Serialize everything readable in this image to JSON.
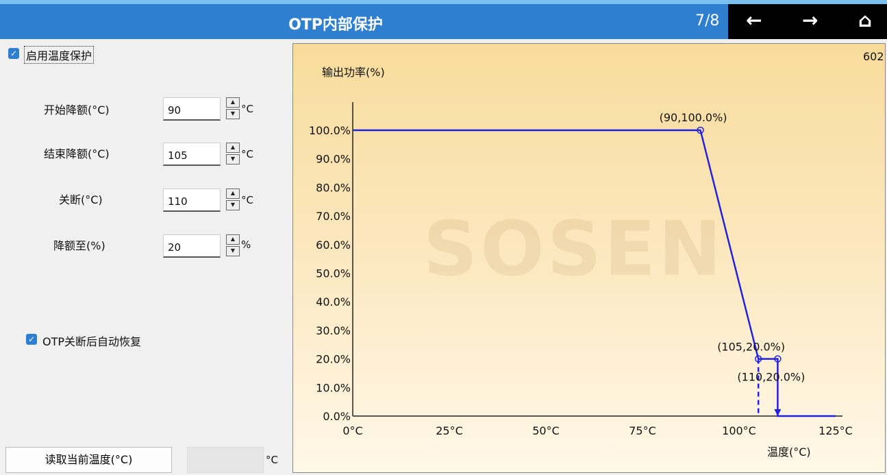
{
  "header": {
    "title": "OTP内部保护",
    "page_indicator": "7/8",
    "back_icon": "←",
    "forward_icon": "→",
    "home_icon": "⌂"
  },
  "settings": {
    "enable_label": "启用温度保护",
    "enable_checked": true,
    "start_derating": {
      "label": "开始降额(°C)",
      "value": "90",
      "unit": "°C"
    },
    "end_derating": {
      "label": "结束降额(°C)",
      "value": "105",
      "unit": "°C"
    },
    "shutdown": {
      "label": "关断(°C)",
      "value": "110",
      "unit": "°C"
    },
    "derate_to": {
      "label": "降额至(%)",
      "value": "20",
      "unit": "%"
    },
    "auto_recover_label": "OTP关断后自动恢复",
    "auto_recover_checked": true,
    "read_temp_button": "读取当前温度(°C)",
    "read_temp_value": "",
    "read_temp_unit": "°C"
  },
  "chart_corner_text": "602",
  "watermark": "SOSEN",
  "chart_data": {
    "type": "line",
    "ylabel": "输出功率(%)",
    "xlabel": "温度(°C)",
    "x_ticks": [
      "0°C",
      "25°C",
      "50°C",
      "75°C",
      "100°C",
      "125°C"
    ],
    "x_tick_values": [
      0,
      25,
      50,
      75,
      100,
      125
    ],
    "y_ticks": [
      "0.0%",
      "10.0%",
      "20.0%",
      "30.0%",
      "40.0%",
      "50.0%",
      "60.0%",
      "70.0%",
      "80.0%",
      "90.0%",
      "100.0%"
    ],
    "y_tick_values": [
      0,
      10,
      20,
      30,
      40,
      50,
      60,
      70,
      80,
      90,
      100
    ],
    "xlim": [
      0,
      125
    ],
    "ylim": [
      0,
      100
    ],
    "series": [
      {
        "values": [
          [
            0,
            100
          ],
          [
            90,
            100
          ],
          [
            105,
            20
          ],
          [
            110,
            20
          ],
          [
            110,
            0
          ],
          [
            125,
            0
          ]
        ],
        "color": "#2222dd"
      }
    ],
    "dashed": [
      [
        105,
        20
      ],
      [
        105,
        0
      ]
    ],
    "points": [
      {
        "x": 90,
        "y": 100,
        "label": "(90,100.0%)"
      },
      {
        "x": 105,
        "y": 20,
        "label": "(105,20.0%)"
      },
      {
        "x": 110,
        "y": 20,
        "label": "(110,20.0%)"
      }
    ]
  }
}
